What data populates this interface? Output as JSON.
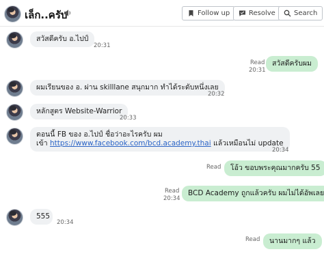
{
  "header": {
    "title": "เล็ก..ครับ",
    "buttons": {
      "follow_up": "Follow up",
      "resolve": "Resolve",
      "search": "Search"
    }
  },
  "messages": [
    {
      "side": "left",
      "text": "สวัสดีครับ อ.ไปป์",
      "time": "20:31"
    },
    {
      "side": "right",
      "text": "สวัสดีครับผม",
      "status": "Read",
      "time": "20:31"
    },
    {
      "side": "left",
      "text": "ผมเรียนของ อ. ผ่าน skilllane สนุกมาก ทำได้ระดับหนึ่งเลย",
      "time": "20:32"
    },
    {
      "side": "left",
      "text": "หลักสูตร Website-Warrior",
      "time": "20:33"
    },
    {
      "side": "left",
      "line1": "ตอนนี้ FB ของ อ.ไปป์ ชื่อว่าอะไรครับ ผม",
      "line2_pre": "เข้า ",
      "line2_link": "https://www.facebook.com/bcd.academy.thai",
      "line2_post": " แล้วเหมือนไม่ update",
      "time": "20:34"
    },
    {
      "side": "right",
      "text": "โอ้ว ขอบพระคุณมากครับ 55",
      "status": "Read"
    },
    {
      "side": "right",
      "text": "BCD Academy ถูกแล้วครับ ผมไม่ได้อัพเลย",
      "status": "Read",
      "time": "20:34"
    },
    {
      "side": "left",
      "text": "555",
      "time": "20:34"
    },
    {
      "side": "right",
      "text": "นานมากๆ แล้ว",
      "status": "Read"
    }
  ]
}
